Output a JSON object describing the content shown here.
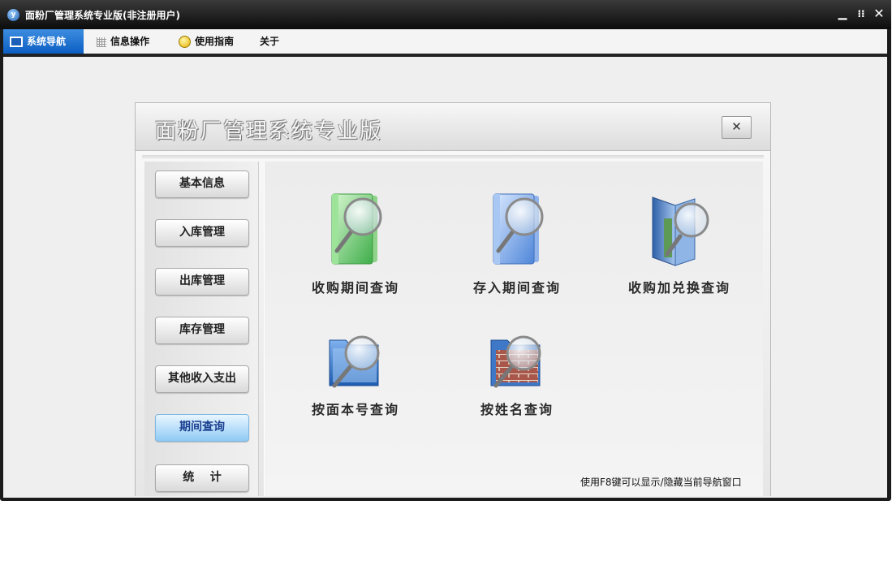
{
  "window": {
    "title": "面粉厂管理系统专业版(非注册用户)",
    "app_icon_glyph": "y",
    "controls": {
      "minimize": "▁",
      "restore": "⁝⁝",
      "close": "✕"
    }
  },
  "menubar": {
    "tabs": [
      {
        "label": "系统导航",
        "icon": "monitor-icon",
        "active": true
      },
      {
        "label": "信息操作",
        "icon": "grid-icon",
        "active": false
      },
      {
        "label": "使用指南",
        "icon": "bulb-icon",
        "active": false
      },
      {
        "label": "关于",
        "icon": "",
        "active": false
      }
    ]
  },
  "panel": {
    "title": "面粉厂管理系统专业版",
    "close_glyph": "✕",
    "sidebar": [
      {
        "label": "基本信息",
        "active": false
      },
      {
        "label": "入库管理",
        "active": false
      },
      {
        "label": "出库管理",
        "active": false
      },
      {
        "label": "库存管理",
        "active": false
      },
      {
        "label": "其他收入支出",
        "active": false
      },
      {
        "label": "期间查询",
        "active": true
      },
      {
        "label": "统    计",
        "active": false
      }
    ],
    "queries": [
      {
        "label": "收购期间查询",
        "icon": "green-book-search-icon"
      },
      {
        "label": "存入期间查询",
        "icon": "blue-book-search-icon"
      },
      {
        "label": "收购加兑换查询",
        "icon": "open-book-search-icon"
      },
      {
        "label": "按面本号查询",
        "icon": "blue-folder-search-icon"
      },
      {
        "label": "按姓名查询",
        "icon": "brick-folder-search-icon"
      }
    ],
    "hint": "使用F8键可以显示/隐藏当前导航窗口"
  },
  "colors": {
    "titlebar": "#1b1b1b",
    "active_tab": "#0c5fc3",
    "active_nav": "#8fcaf5"
  }
}
